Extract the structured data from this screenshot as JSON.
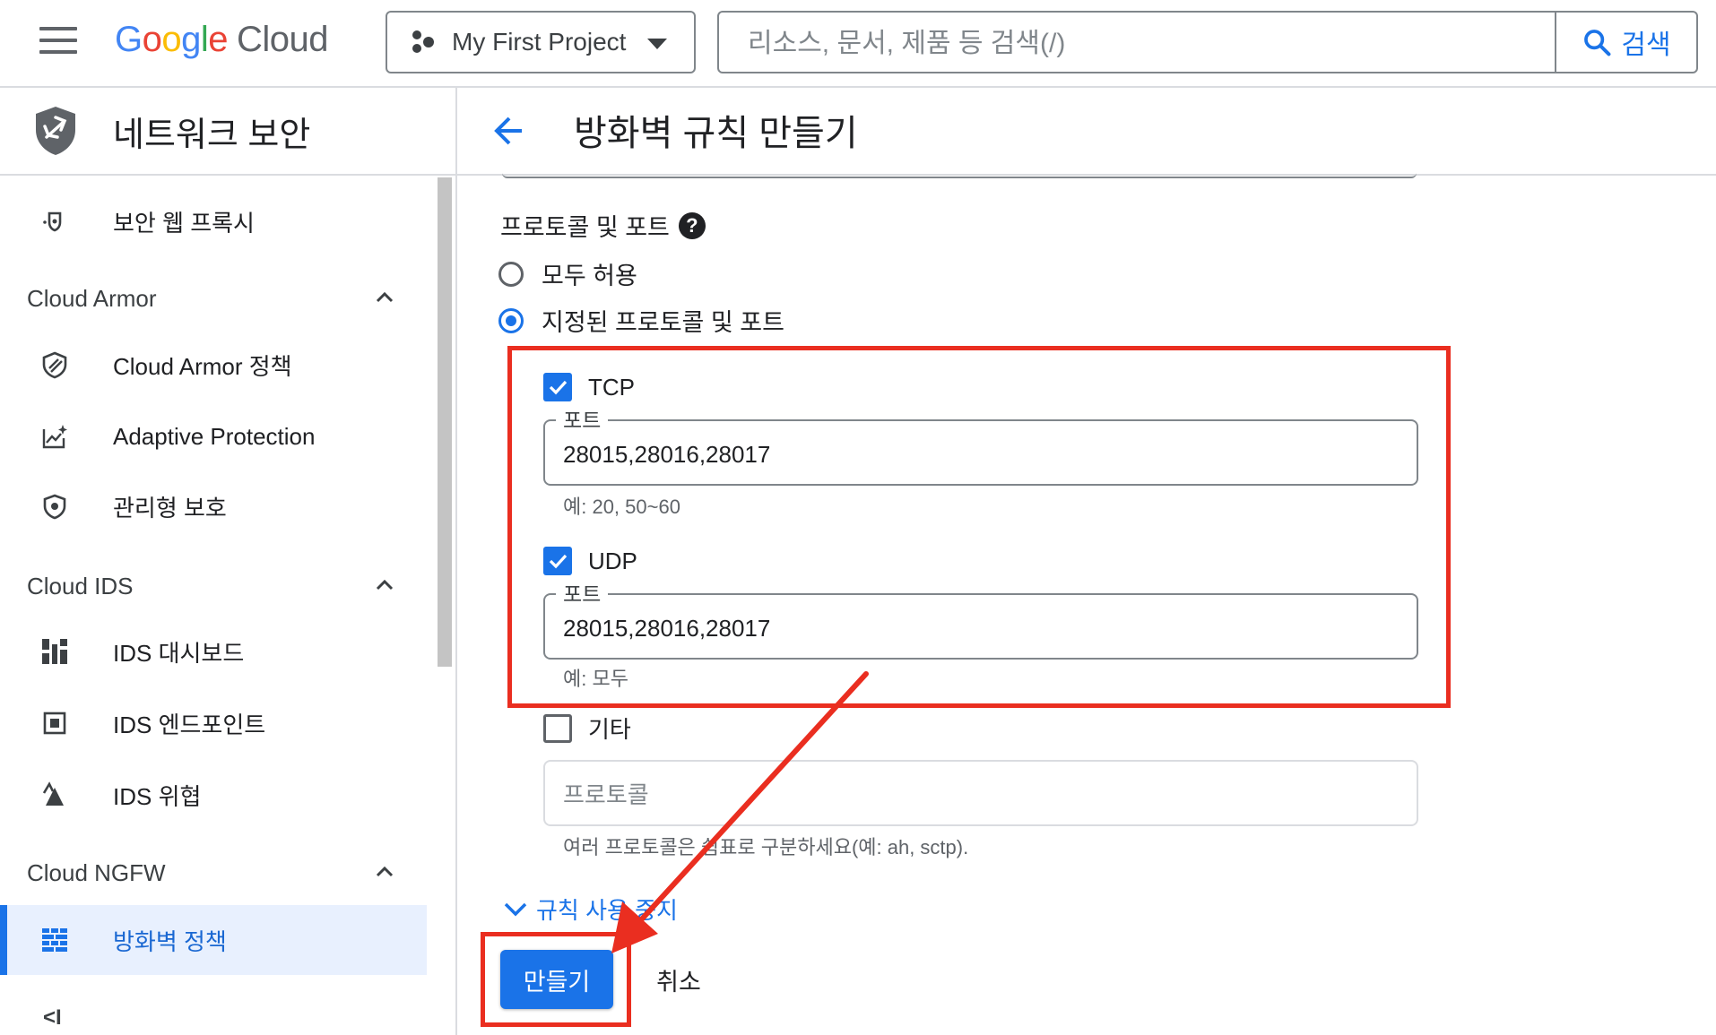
{
  "header": {
    "logo_google": [
      "G",
      "o",
      "o",
      "g",
      "l",
      "e"
    ],
    "logo_cloud": "Cloud",
    "project": "My First Project",
    "search_placeholder": "리소스, 문서, 제품 등 검색(/)",
    "search_button": "검색"
  },
  "sidebar": {
    "title": "네트워크 보안",
    "items": [
      {
        "label": "보안 웹 프록시",
        "icon": "web-proxy-icon"
      },
      {
        "section": "Cloud Armor"
      },
      {
        "label": "Cloud Armor 정책",
        "icon": "armor-shield-icon"
      },
      {
        "label": "Adaptive Protection",
        "icon": "chart-sparkle-icon"
      },
      {
        "label": "관리형 보호",
        "icon": "shield-icon"
      },
      {
        "section": "Cloud IDS"
      },
      {
        "label": "IDS 대시보드",
        "icon": "dashboard-icon"
      },
      {
        "label": "IDS 엔드포인트",
        "icon": "endpoint-icon"
      },
      {
        "label": "IDS 위협",
        "icon": "threat-icon"
      },
      {
        "section": "Cloud NGFW"
      },
      {
        "label": "방화벽 정책",
        "icon": "firewall-icon",
        "active": true
      }
    ],
    "collapse": "<I"
  },
  "page": {
    "title": "방화벽 규칙 만들기",
    "protocols_label": "프로토콜 및 포트",
    "radio_allow_all": "모두 허용",
    "radio_specified": "지정된 프로토콜 및 포트",
    "tcp": {
      "label": "TCP",
      "checked": true,
      "port_label": "포트",
      "ports": "28015,28016,28017",
      "hint": "예: 20, 50~60"
    },
    "udp": {
      "label": "UDP",
      "checked": true,
      "port_label": "포트",
      "ports": "28015,28016,28017",
      "hint": "예: 모두"
    },
    "other": {
      "label": "기타",
      "checked": false,
      "placeholder": "프로토콜",
      "hint": "여러 프로토콜은 쉼표로 구분하세요(예: ah, sctp)."
    },
    "disable_rule_link": "규칙 사용 중지",
    "create_button": "만들기",
    "cancel_button": "취소"
  },
  "colors": {
    "accent": "#1a73e8",
    "highlight": "#ea2e20"
  }
}
